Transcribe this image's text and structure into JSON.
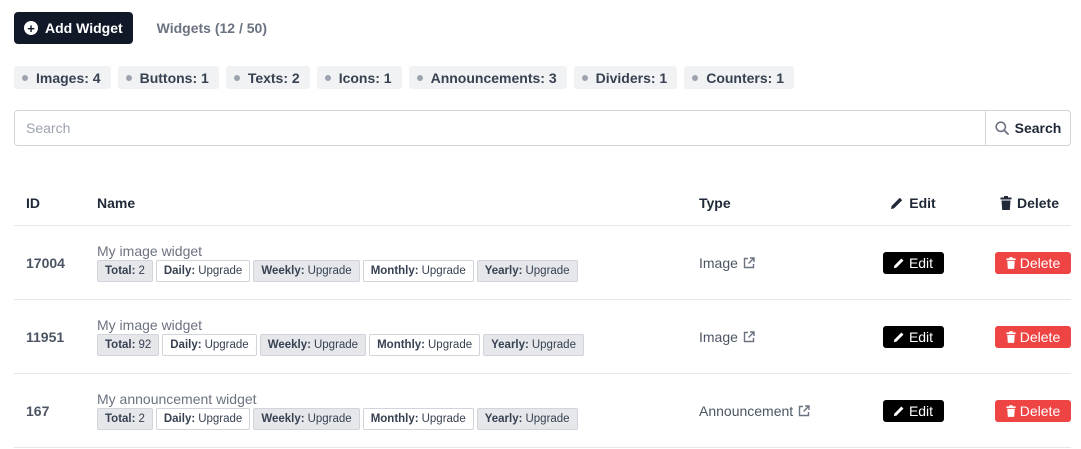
{
  "toolbar": {
    "add_label": "Add Widget",
    "count_label": "Widgets (12 / 50)"
  },
  "chips": [
    {
      "label": "Images: 4"
    },
    {
      "label": "Buttons: 1"
    },
    {
      "label": "Texts: 2"
    },
    {
      "label": "Icons: 1"
    },
    {
      "label": "Announcements: 3"
    },
    {
      "label": "Dividers: 1"
    },
    {
      "label": "Counters: 1"
    }
  ],
  "search": {
    "placeholder": "Search",
    "button_label": "Search"
  },
  "table": {
    "headers": {
      "id": "ID",
      "name": "Name",
      "type": "Type",
      "edit": "Edit",
      "delete": "Delete"
    },
    "rows": [
      {
        "id": "17004",
        "name": "My image widget",
        "type": "Image",
        "stats": [
          {
            "label": "Total:",
            "value": "2"
          },
          {
            "label": "Daily:",
            "value": "Upgrade"
          },
          {
            "label": "Weekly:",
            "value": "Upgrade"
          },
          {
            "label": "Monthly:",
            "value": "Upgrade"
          },
          {
            "label": "Yearly:",
            "value": "Upgrade"
          }
        ],
        "edit_label": "Edit",
        "delete_label": "Delete"
      },
      {
        "id": "11951",
        "name": "My image widget",
        "type": "Image",
        "stats": [
          {
            "label": "Total:",
            "value": "92"
          },
          {
            "label": "Daily:",
            "value": "Upgrade"
          },
          {
            "label": "Weekly:",
            "value": "Upgrade"
          },
          {
            "label": "Monthly:",
            "value": "Upgrade"
          },
          {
            "label": "Yearly:",
            "value": "Upgrade"
          }
        ],
        "edit_label": "Edit",
        "delete_label": "Delete"
      },
      {
        "id": "167",
        "name": "My announcement widget",
        "type": "Announcement",
        "stats": [
          {
            "label": "Total:",
            "value": "2"
          },
          {
            "label": "Daily:",
            "value": "Upgrade"
          },
          {
            "label": "Weekly:",
            "value": "Upgrade"
          },
          {
            "label": "Monthly:",
            "value": "Upgrade"
          },
          {
            "label": "Yearly:",
            "value": "Upgrade"
          }
        ],
        "edit_label": "Edit",
        "delete_label": "Delete"
      }
    ]
  },
  "icons": {
    "add": "plus-circle-icon",
    "chip": "dot-icon",
    "search": "magnifier-icon",
    "edit": "pencil-icon",
    "delete": "trash-icon",
    "external": "external-link-icon"
  },
  "colors": {
    "primary_dark": "#111827",
    "danger": "#ef4444",
    "chip_bg": "#f1f2f4",
    "border": "#d1d5db"
  }
}
